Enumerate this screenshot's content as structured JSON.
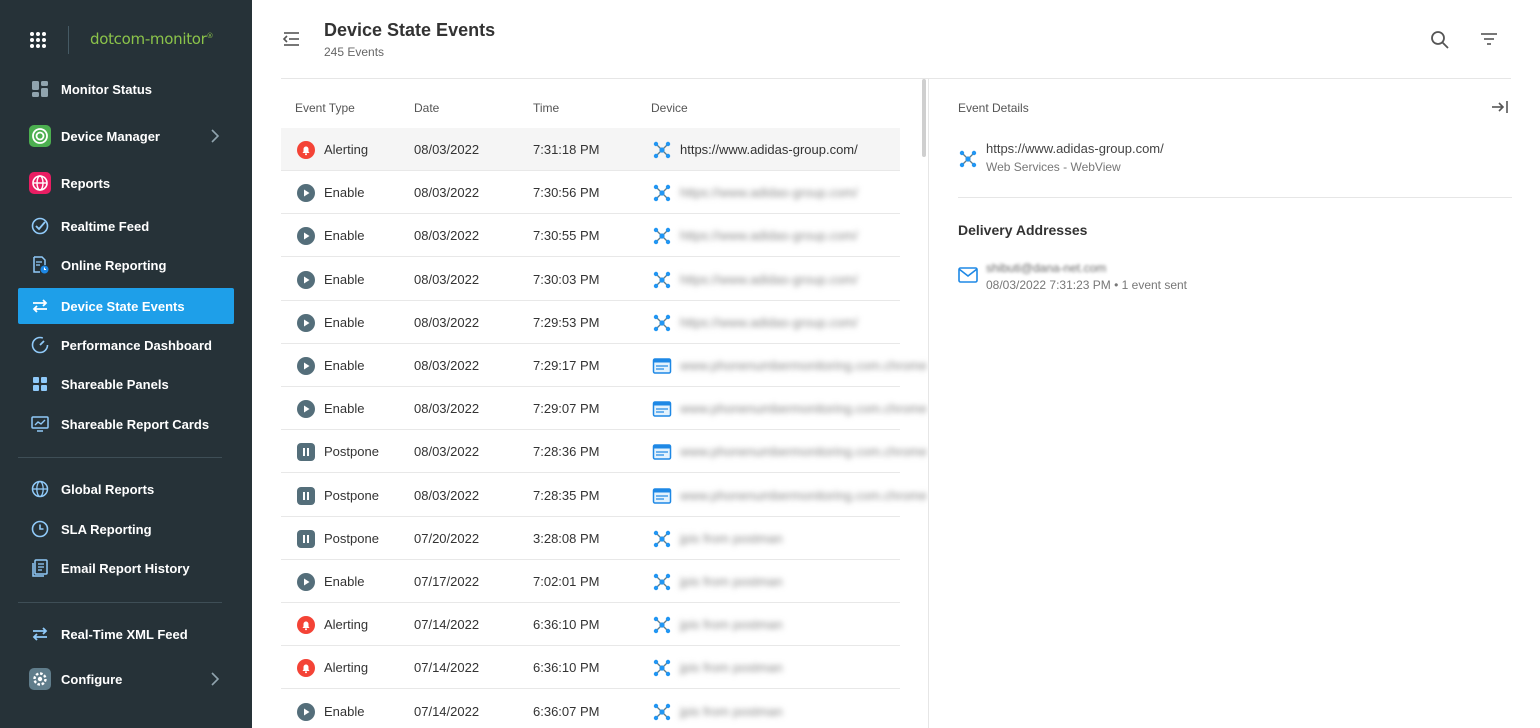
{
  "app": {
    "logo_text": "dotcom-monitor",
    "logo_mark": "®"
  },
  "sidebar": {
    "items": [
      {
        "label": "Monitor Status",
        "icon": "dashboard-icon"
      },
      {
        "label": "Device Manager",
        "icon": "target-icon"
      },
      {
        "label": "Reports",
        "icon": "globe-icon"
      },
      {
        "label": "Realtime Feed",
        "icon": "check-circle-icon"
      },
      {
        "label": "Online Reporting",
        "icon": "report-clock-icon"
      },
      {
        "label": "Device State Events",
        "icon": "swap-icon"
      },
      {
        "label": "Performance Dashboard",
        "icon": "gauge-icon"
      },
      {
        "label": "Shareable Panels",
        "icon": "panels-icon"
      },
      {
        "label": "Shareable Report Cards",
        "icon": "monitor-chart-icon"
      },
      {
        "label": "Global Reports",
        "icon": "globe-outline-icon"
      },
      {
        "label": "SLA Reporting",
        "icon": "clock-icon"
      },
      {
        "label": "Email Report History",
        "icon": "history-icon"
      },
      {
        "label": "Real-Time XML Feed",
        "icon": "swap-icon"
      },
      {
        "label": "Configure",
        "icon": "gear-icon"
      }
    ]
  },
  "header": {
    "title": "Device State Events",
    "subtitle": "245 Events"
  },
  "table": {
    "columns": [
      "Event Type",
      "Date",
      "Time",
      "Device"
    ],
    "rows": [
      {
        "event": "Alerting",
        "date": "08/03/2022",
        "time": "7:31:18 PM",
        "device": "https://www.adidas-group.com/"
      },
      {
        "event": "Enable",
        "date": "08/03/2022",
        "time": "7:30:56 PM",
        "device": "https://www.adidas-group.com/"
      },
      {
        "event": "Enable",
        "date": "08/03/2022",
        "time": "7:30:55 PM",
        "device": "https://www.adidas-group.com/"
      },
      {
        "event": "Enable",
        "date": "08/03/2022",
        "time": "7:30:03 PM",
        "device": "https://www.adidas-group.com/"
      },
      {
        "event": "Enable",
        "date": "08/03/2022",
        "time": "7:29:53 PM",
        "device": "https://www.adidas-group.com/"
      },
      {
        "event": "Enable",
        "date": "08/03/2022",
        "time": "7:29:17 PM",
        "device": "www.phonenumbermonitoring.com.chrome"
      },
      {
        "event": "Enable",
        "date": "08/03/2022",
        "time": "7:29:07 PM",
        "device": "www.phonenumbermonitoring.com.chrome"
      },
      {
        "event": "Postpone",
        "date": "08/03/2022",
        "time": "7:28:36 PM",
        "device": "www.phonenumbermonitoring.com.chrome"
      },
      {
        "event": "Postpone",
        "date": "08/03/2022",
        "time": "7:28:35 PM",
        "device": "www.phonenumbermonitoring.com.chrome"
      },
      {
        "event": "Postpone",
        "date": "07/20/2022",
        "time": "3:28:08 PM",
        "device": "jpis from postman"
      },
      {
        "event": "Enable",
        "date": "07/17/2022",
        "time": "7:02:01 PM",
        "device": "jpis from postman"
      },
      {
        "event": "Alerting",
        "date": "07/14/2022",
        "time": "6:36:10 PM",
        "device": "jpis from postman"
      },
      {
        "event": "Alerting",
        "date": "07/14/2022",
        "time": "6:36:10 PM",
        "device": "jpis from postman"
      },
      {
        "event": "Enable",
        "date": "07/14/2022",
        "time": "6:36:07 PM",
        "device": "jpis from postman"
      }
    ]
  },
  "details": {
    "heading": "Event Details",
    "device_url": "https://www.adidas-group.com/",
    "device_type": "Web Services - WebView",
    "delivery_heading": "Delivery Addresses",
    "email": "shibuti@dana-net.com",
    "delivery_info": "08/03/2022 7:31:23 PM • 1 event sent"
  },
  "colors": {
    "sidebar_bg": "#263238",
    "active": "#1e9fe9",
    "alert": "#f44336",
    "enable": "#546e7a",
    "device_icon": "#2196f3"
  }
}
